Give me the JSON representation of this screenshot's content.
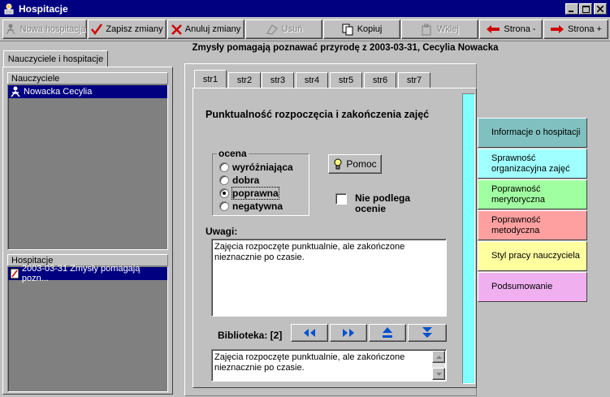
{
  "window": {
    "title": "Hospitacje"
  },
  "toolbar": {
    "new_label": "Nowa hospitacja",
    "save_label": "Zapisz zmiany",
    "cancel_label": "Anuluj zmiany",
    "delete_label": "Usuń",
    "copy_label": "Kopiuj",
    "paste_label": "Wklej",
    "prev_label": "Strona -",
    "next_label": "Strona +"
  },
  "left_panel": {
    "tab_label": "Nauczyciele i hospitacje",
    "teachers_header": "Nauczyciele",
    "teachers": [
      "Nowacka Cecylia"
    ],
    "inspections_header": "Hospitacje",
    "inspections": [
      "2003-03-31 Zmysły pomagają pozn..."
    ]
  },
  "main": {
    "heading": "Zmysły pomagają poznawać przyrodę z 2003-03-31, Cecylia Nowacka",
    "tabs": [
      "str1",
      "str2",
      "str3",
      "str4",
      "str5",
      "str6",
      "str7"
    ],
    "active_tab": "str1",
    "question": "Punktualność rozpoczęcia i zakończenia zajęć",
    "rating_group_label": "ocena",
    "ratings": [
      {
        "label": "wyróżniająca",
        "selected": false
      },
      {
        "label": "dobra",
        "selected": false
      },
      {
        "label": "poprawna",
        "selected": true
      },
      {
        "label": "negatywna",
        "selected": false
      }
    ],
    "help_label": "Pomoc",
    "not_applicable_label": "Nie podlega ocenie",
    "remarks_label": "Uwagi:",
    "remarks_value": "Zajęcia rozpoczęte  punktualnie, ale zakończone nieznacznie po czasie.",
    "library_label": "Biblioteka: [2]",
    "library_value": "Zajęcia rozpoczęte  punktualnie, ale zakończone nieznacznie po czasie."
  },
  "side_panel": {
    "buttons": [
      {
        "label": "Informacje o hospitacji",
        "color": "#80c0c0"
      },
      {
        "label": "Sprawność organizacyjna zajęć",
        "color": "#a0ffff"
      },
      {
        "label": "Poprawność merytoryczna",
        "color": "#a0ffa0"
      },
      {
        "label": "Poprawność metodyczna",
        "color": "#ffa0a0"
      },
      {
        "label": "Styl pracy nauczyciela",
        "color": "#ffffa0"
      },
      {
        "label": "Podsumowanie",
        "color": "#f0b0f0"
      }
    ]
  },
  "colors": {
    "title_bar": "#000080",
    "selection": "#000080",
    "accent_strip": "#80ffff"
  }
}
